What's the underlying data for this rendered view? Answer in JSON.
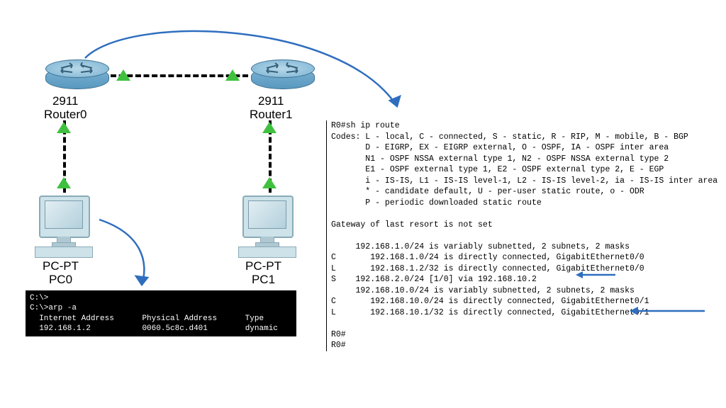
{
  "devices": {
    "router0": {
      "model": "2911",
      "name": "Router0"
    },
    "router1": {
      "model": "2911",
      "name": "Router1"
    },
    "pc0": {
      "model": "PC-PT",
      "name": "PC0"
    },
    "pc1": {
      "model": "PC-PT",
      "name": "PC1"
    }
  },
  "terminal": {
    "prompt1": "C:\\>",
    "prompt2": "C:\\>arp -a",
    "hdr_ip": "  Internet Address",
    "hdr_mac": "Physical Address",
    "hdr_type": "Type",
    "row_ip": "  192.168.1.2",
    "row_mac": "0060.5c8c.d401",
    "row_type": "dynamic"
  },
  "cli": {
    "line1": "R0#sh ip route",
    "line2": "Codes: L - local, C - connected, S - static, R - RIP, M - mobile, B - BGP",
    "line3": "       D - EIGRP, EX - EIGRP external, O - OSPF, IA - OSPF inter area",
    "line4": "       N1 - OSPF NSSA external type 1, N2 - OSPF NSSA external type 2",
    "line5": "       E1 - OSPF external type 1, E2 - OSPF external type 2, E - EGP",
    "line6": "       i - IS-IS, L1 - IS-IS level-1, L2 - IS-IS level-2, ia - IS-IS inter area",
    "line7": "       * - candidate default, U - per-user static route, o - ODR",
    "line8": "       P - periodic downloaded static route",
    "line9": "",
    "line10": "Gateway of last resort is not set",
    "line11": "",
    "line12": "     192.168.1.0/24 is variably subnetted, 2 subnets, 2 masks",
    "line13": "C       192.168.1.0/24 is directly connected, GigabitEthernet0/0",
    "line14": "L       192.168.1.2/32 is directly connected, GigabitEthernet0/0",
    "line15": "S    192.168.2.0/24 [1/0] via 192.168.10.2",
    "line16": "     192.168.10.0/24 is variably subnetted, 2 subnets, 2 masks",
    "line17": "C       192.168.10.0/24 is directly connected, GigabitEthernet0/1",
    "line18": "L       192.168.10.1/32 is directly connected, GigabitEthernet0/1",
    "line19": "",
    "line20": "R0#",
    "line21": "R0#"
  }
}
